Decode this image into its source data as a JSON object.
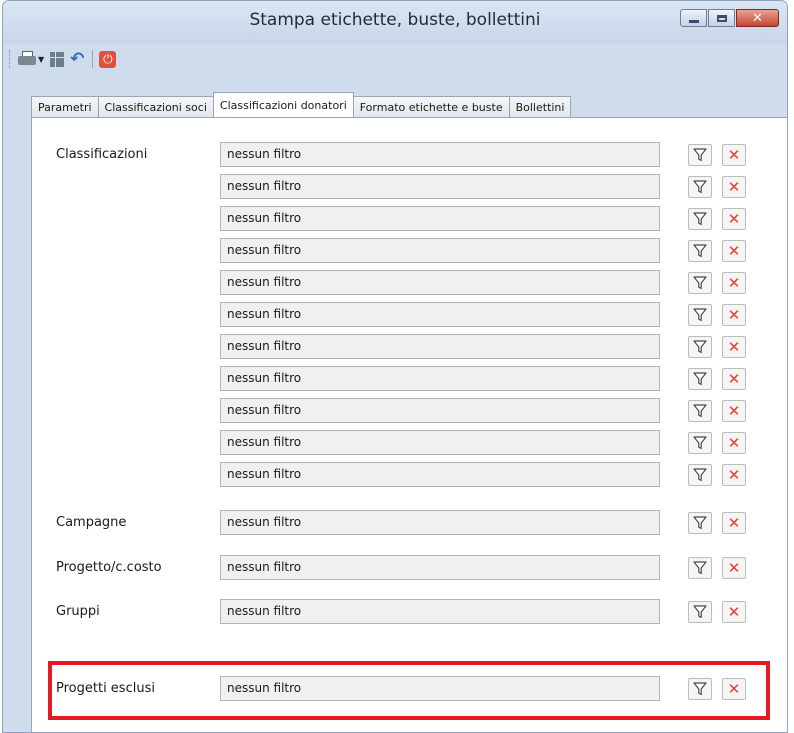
{
  "window": {
    "title": "Stampa etichette, buste, bollettini"
  },
  "tabs": [
    {
      "label": "Parametri"
    },
    {
      "label": "Classificazioni soci"
    },
    {
      "label": "Classificazioni donatori",
      "active": true
    },
    {
      "label": "Formato etichette e buste"
    },
    {
      "label": "Bollettini"
    }
  ],
  "rows": [
    {
      "label": "Classificazioni",
      "value": "nessun filtro"
    },
    {
      "label": "",
      "value": "nessun filtro"
    },
    {
      "label": "",
      "value": "nessun filtro"
    },
    {
      "label": "",
      "value": "nessun filtro"
    },
    {
      "label": "",
      "value": "nessun filtro"
    },
    {
      "label": "",
      "value": "nessun filtro"
    },
    {
      "label": "",
      "value": "nessun filtro"
    },
    {
      "label": "",
      "value": "nessun filtro"
    },
    {
      "label": "",
      "value": "nessun filtro"
    },
    {
      "label": "",
      "value": "nessun filtro"
    },
    {
      "label": "",
      "value": "nessun filtro"
    },
    {
      "label": "Campagne",
      "value": "nessun filtro"
    },
    {
      "label": "Progetto/c.costo",
      "value": "nessun filtro"
    },
    {
      "label": "Gruppi",
      "value": "nessun filtro"
    },
    {
      "label": "Progetti esclusi",
      "value": "nessun filtro"
    }
  ],
  "icons": {
    "filter": "funnel-icon",
    "clear": "close-icon"
  },
  "colors": {
    "highlight": "#e31b23",
    "clear_icon": "#e1442e"
  }
}
